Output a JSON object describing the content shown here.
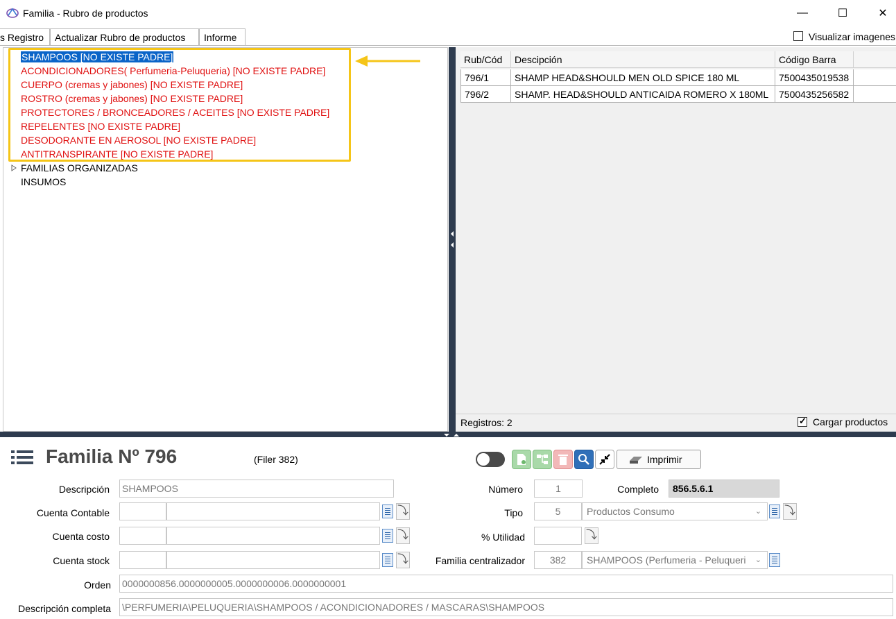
{
  "window": {
    "title": "Familia - Rubro de productos",
    "minimize": "—",
    "maximize": "☐",
    "close": "✕"
  },
  "tabs": [
    {
      "label": "s Registro"
    },
    {
      "label": "Actualizar Rubro de productos"
    },
    {
      "label": "Informe"
    }
  ],
  "visualizar_imagenes": {
    "label": "Visualizar imagenes",
    "checked": false
  },
  "tree": {
    "items": [
      {
        "label": "SHAMPOOS [NO EXISTE PADRE]",
        "selected": true
      },
      {
        "label": "ACONDICIONADORES( Perfumeria-Peluqueria) [NO EXISTE PADRE]"
      },
      {
        "label": "CUERPO (cremas y jabones) [NO EXISTE PADRE]"
      },
      {
        "label": "ROSTRO (cremas y jabones) [NO EXISTE PADRE]"
      },
      {
        "label": "PROTECTORES / BRONCEADORES / ACEITES [NO EXISTE PADRE]"
      },
      {
        "label": "REPELENTES [NO EXISTE PADRE]"
      },
      {
        "label": "DESODORANTE EN AEROSOL [NO EXISTE PADRE]"
      },
      {
        "label": "ANTITRANSPIRANTE [NO EXISTE PADRE]"
      },
      {
        "label": "FAMILIAS ORGANIZADAS"
      },
      {
        "label": "INSUMOS"
      }
    ],
    "error_color": "#e01010",
    "highlight_color": "#f5c518"
  },
  "grid": {
    "columns": [
      "Rub/Cód",
      "Descipción",
      "Código Barra"
    ],
    "rows": [
      [
        "796/1",
        "SHAMP HEAD&SHOULD MEN OLD SPICE 180 ML",
        "7500435019538"
      ],
      [
        "796/2",
        "SHAMP. HEAD&SHOULD ANTICAIDA ROMERO X 180ML",
        "7500435256582"
      ]
    ],
    "registros": "Registros: 2",
    "cargar_productos": {
      "label": "Cargar productos",
      "checked": true
    }
  },
  "form": {
    "title": "Familia Nº 796",
    "filer": "(Filer 382)",
    "imprimir": "Imprimir",
    "labels": {
      "descripcion": "Descripción",
      "cuenta_contable": "Cuenta Contable",
      "cuenta_costo": "Cuenta costo",
      "cuenta_stock": "Cuenta stock",
      "orden": "Orden",
      "descripcion_completa": "Descripción completa",
      "numero": "Número",
      "completo": "Completo",
      "tipo": "Tipo",
      "utilidad": "% Utilidad",
      "familia_centralizador": "Familia centralizador"
    },
    "values": {
      "descripcion": "SHAMPOOS",
      "numero": "1",
      "completo": "856.5.6.1",
      "tipo_code": "5",
      "tipo_desc": "Productos Consumo",
      "familia_centralizador_code": "382",
      "familia_centralizador_desc": "SHAMPOOS (Perfumeria - Peluqueri",
      "orden": "0000000856.0000000005.0000000006.0000000001",
      "descripcion_completa": "\\PERFUMERIA\\PELUQUERIA\\SHAMPOOS / ACONDICIONADORES / MASCARAS\\SHAMPOOS"
    }
  }
}
